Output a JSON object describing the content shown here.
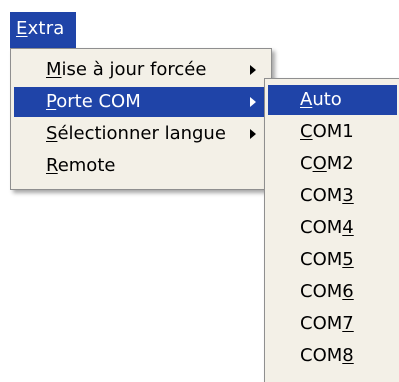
{
  "menubar": {
    "extra": {
      "pre": "",
      "ul": "E",
      "post": "xtra"
    }
  },
  "menu": {
    "items": [
      {
        "pre": "",
        "ul": "M",
        "post": "ise à jour forcée",
        "submenu": true
      },
      {
        "pre": "",
        "ul": "P",
        "post": "orte COM",
        "submenu": true
      },
      {
        "pre": "",
        "ul": "S",
        "post": "électionner langue",
        "submenu": true
      },
      {
        "pre": "",
        "ul": "R",
        "post": "emote",
        "submenu": false
      }
    ]
  },
  "submenu": {
    "items": [
      {
        "pre": "",
        "ul": "A",
        "post": "uto"
      },
      {
        "pre": "",
        "ul": "C",
        "post": "OM1"
      },
      {
        "pre": "C",
        "ul": "O",
        "post": "M2"
      },
      {
        "pre": "COM",
        "ul": "3",
        "post": ""
      },
      {
        "pre": "COM",
        "ul": "4",
        "post": ""
      },
      {
        "pre": "COM",
        "ul": "5",
        "post": ""
      },
      {
        "pre": "COM",
        "ul": "6",
        "post": ""
      },
      {
        "pre": "COM",
        "ul": "7",
        "post": ""
      },
      {
        "pre": "COM",
        "ul": "8",
        "post": ""
      }
    ]
  },
  "colors": {
    "highlight": "#1f44a8",
    "menu_bg": "#f3f0e7"
  }
}
